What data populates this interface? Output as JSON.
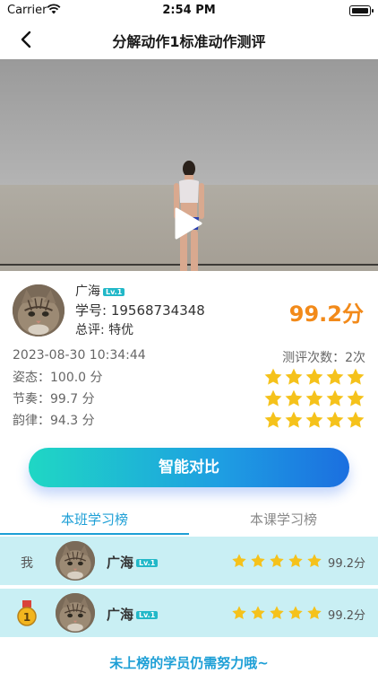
{
  "status_bar": {
    "carrier": "Carrier",
    "time": "2:54 PM"
  },
  "nav": {
    "title": "分解动作1标准动作测评"
  },
  "video": {
    "play_icon": "play-icon"
  },
  "profile": {
    "name": "广海",
    "level": "Lv.1",
    "student_id_label": "学号:",
    "student_id": "19568734348",
    "eval_label": "总评:",
    "eval_value": "特优",
    "score": "99.2分"
  },
  "stats": {
    "datetime": "2023-08-30 10:34:44",
    "eval_count": "测评次数：2次",
    "metrics": [
      {
        "label": "姿态：100.0 分",
        "stars": 5
      },
      {
        "label": "节奏：99.7 分",
        "stars": 5
      },
      {
        "label": "韵律：94.3 分",
        "stars": 5
      }
    ]
  },
  "compare_button": "智能对比",
  "tabs": [
    {
      "label": "本班学习榜",
      "active": true
    },
    {
      "label": "本课学习榜",
      "active": false
    }
  ],
  "ranking": [
    {
      "rank_label": "我",
      "name": "广海",
      "level": "Lv.1",
      "stars": 5,
      "score": "99.2分"
    },
    {
      "rank_label": "1",
      "name": "广海",
      "level": "Lv.1",
      "stars": 5,
      "score": "99.2分"
    }
  ],
  "footer": "未上榜的学员仍需努力哦~",
  "colors": {
    "accent": "#1d9fd6",
    "score": "#f28a1a",
    "star": "#f5c21b",
    "rank_bg": "#c9eff4"
  }
}
